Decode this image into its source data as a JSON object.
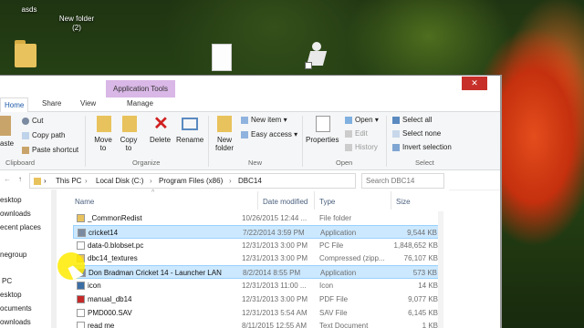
{
  "desktop": {
    "icons": [
      {
        "label": "asds"
      },
      {
        "label": "New folder\n(2)"
      },
      {
        "label": ""
      },
      {
        "label": ""
      },
      {
        "label": ""
      }
    ]
  },
  "window": {
    "app_tools_label": "Application Tools",
    "close_glyph": "✕",
    "tabs": [
      "Home",
      "Share",
      "View",
      "Manage"
    ],
    "ribbon": {
      "clipboard": {
        "cut": "Cut",
        "copy_path": "Copy path",
        "paste_shortcut": "Paste shortcut",
        "paste": "aste",
        "label": "Clipboard"
      },
      "organize": {
        "move_to": [
          "Move",
          "to"
        ],
        "copy_to": [
          "Copy",
          "to"
        ],
        "delete": "Delete",
        "rename": "Rename",
        "label": "Organize"
      },
      "new": {
        "new_folder": [
          "New",
          "folder"
        ],
        "new_item": "New item",
        "easy_access": "Easy access",
        "label": "New"
      },
      "open": {
        "properties": "Properties",
        "open": "Open",
        "edit": "Edit",
        "history": "History",
        "label": "Open"
      },
      "select": {
        "select_all": "Select all",
        "select_none": "Select none",
        "invert_selection": "Invert selection",
        "label": "Select"
      }
    },
    "address": {
      "path": [
        "This PC",
        "Local Disk (C:)",
        "Program Files (x86)",
        "DBC14"
      ],
      "search_placeholder": "Search DBC14"
    },
    "nav_items": [
      "esktop",
      "ownloads",
      "ecent places",
      "negroup",
      "PC",
      "esktop",
      "ocuments",
      "ownloads"
    ],
    "columns": {
      "name": "Name",
      "date": "Date modified",
      "type": "Type",
      "size": "Size"
    },
    "files": [
      {
        "name": "_CommonRedist",
        "date": "10/26/2015 12:44 ...",
        "type": "File folder",
        "size": "",
        "icon": "folder-icon",
        "selected": false
      },
      {
        "name": "cricket14",
        "date": "7/22/2014 3:59 PM",
        "type": "Application",
        "size": "9,544 KB",
        "icon": "application-icon",
        "selected": true
      },
      {
        "name": "data-0.blobset.pc",
        "date": "12/31/2013 3:00 PM",
        "type": "PC File",
        "size": "1,848,652 KB",
        "icon": "file-icon",
        "selected": false
      },
      {
        "name": "dbc14_textures",
        "date": "12/31/2013 3:00 PM",
        "type": "Compressed (zipp...",
        "size": "76,107 KB",
        "icon": "zip-icon",
        "selected": false
      },
      {
        "name": "Don Bradman Cricket 14 - Launcher LAN",
        "date": "8/2/2014 8:55 PM",
        "type": "Application",
        "size": "573 KB",
        "icon": "application-icon",
        "selected": true
      },
      {
        "name": "icon",
        "date": "12/31/2013 11:00 ...",
        "type": "Icon",
        "size": "14 KB",
        "icon": "icon-file-icon",
        "selected": false
      },
      {
        "name": "manual_db14",
        "date": "12/31/2013 3:00 PM",
        "type": "PDF File",
        "size": "9,077 KB",
        "icon": "pdf-icon",
        "selected": false
      },
      {
        "name": "PMD000.SAV",
        "date": "12/31/2013 5:54 AM",
        "type": "SAV File",
        "size": "6,145 KB",
        "icon": "file-icon",
        "selected": false
      },
      {
        "name": "read me",
        "date": "8/11/2015 12:55 AM",
        "type": "Text Document",
        "size": "1 KB",
        "icon": "text-icon",
        "selected": false
      }
    ]
  }
}
